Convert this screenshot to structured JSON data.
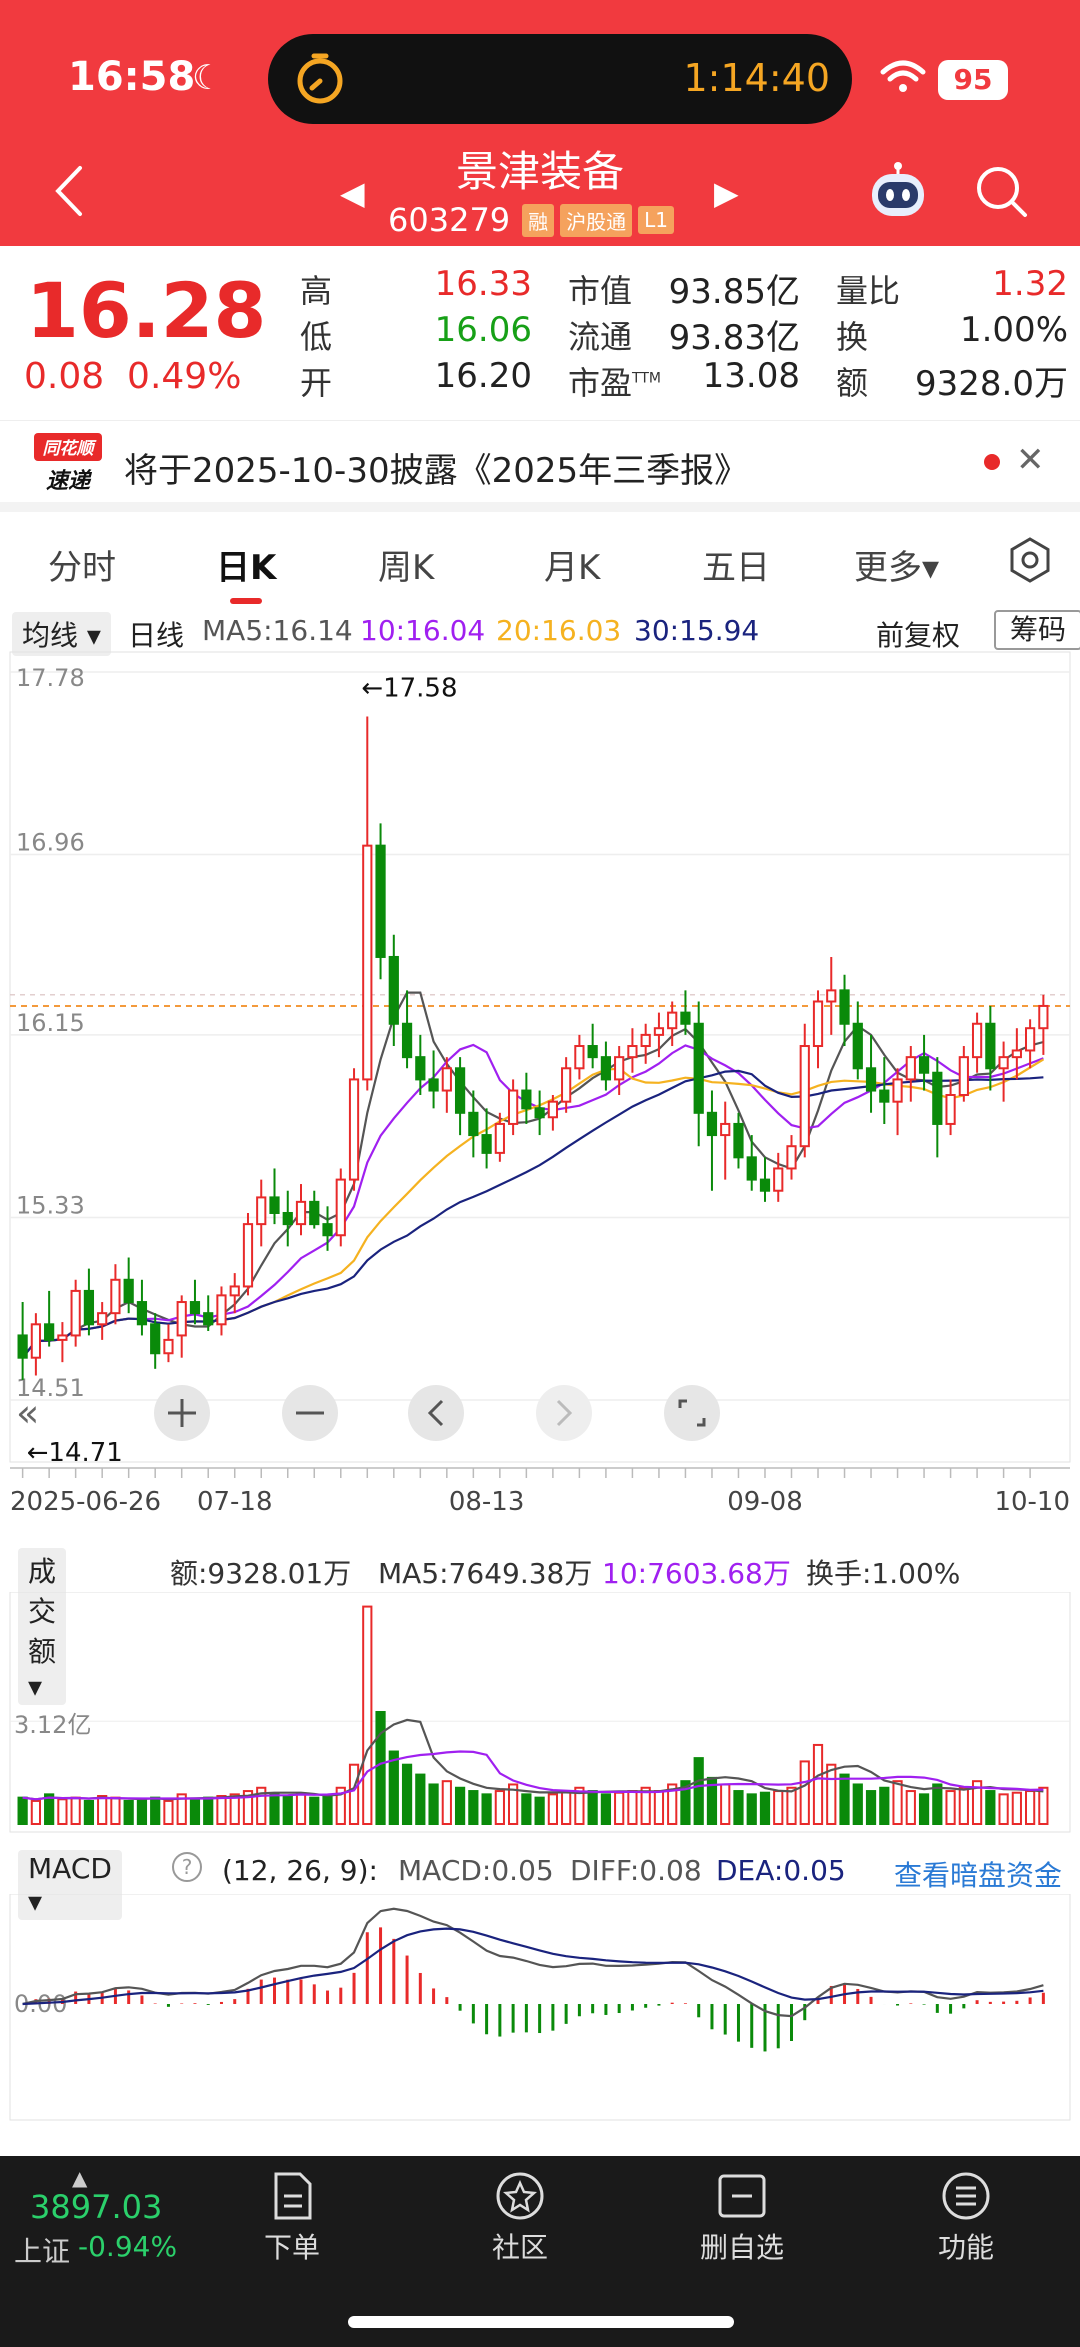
{
  "status": {
    "time": "16:58",
    "island_time": "1:14:40",
    "battery": "95"
  },
  "header": {
    "stock_name": "景津装备",
    "code": "603279",
    "tags": [
      "融",
      "沪股通",
      "L1"
    ]
  },
  "quote": {
    "price": "16.28",
    "change": "0.08",
    "change_pct": "0.49%",
    "high_label": "高",
    "high": "16.33",
    "low_label": "低",
    "low": "16.06",
    "open_label": "开",
    "open": "16.20",
    "mcap_label": "市值",
    "mcap": "93.85亿",
    "float_label": "流通",
    "float": "93.83亿",
    "pe_label": "市盈",
    "pe_sup": "TTM",
    "pe": "13.08",
    "vr_label": "量比",
    "vr": "1.32",
    "turn_label": "换",
    "turn": "1.00%",
    "amt_label": "额",
    "amt": "9328.0万"
  },
  "news": {
    "logo_top": "同花顺",
    "logo_bottom": "速递",
    "text": "将于2025-10-30披露《2025年三季报》"
  },
  "tabs": [
    "分时",
    "日K",
    "周K",
    "月K",
    "五日",
    "更多▾"
  ],
  "ma": {
    "type_label": "均线 ▾",
    "period": "日线",
    "ma5": "MA5:16.14",
    "ma10": "10:16.04",
    "ma20": "20:16.03",
    "ma30": "30:15.94",
    "adjust": "前复权",
    "chip": "筹码"
  },
  "colors": {
    "up": "#e82a2a",
    "down": "#0a8a0a",
    "ma5": "#555555",
    "ma10": "#a020f0",
    "ma20": "#f5b220",
    "ma30": "#1a237e"
  },
  "chart_data": {
    "type": "candlestick",
    "ylim": [
      14.51,
      17.78
    ],
    "y_ticks": [
      "17.78",
      "16.96",
      "16.15",
      "15.33",
      "14.51"
    ],
    "x_ticks": [
      "2025-06-26",
      "07-18",
      "08-13",
      "09-08",
      "10-10"
    ],
    "annotations": {
      "high": "←17.58",
      "low": "←14.71"
    },
    "candles": [
      [
        14.8,
        14.95,
        14.6,
        14.7
      ],
      [
        14.7,
        14.9,
        14.62,
        14.85
      ],
      [
        14.85,
        15.0,
        14.75,
        14.78
      ],
      [
        14.78,
        14.86,
        14.68,
        14.8
      ],
      [
        14.8,
        15.05,
        14.75,
        15.0
      ],
      [
        15.0,
        15.1,
        14.8,
        14.85
      ],
      [
        14.85,
        14.95,
        14.78,
        14.9
      ],
      [
        14.9,
        15.12,
        14.85,
        15.05
      ],
      [
        15.05,
        15.15,
        14.9,
        14.95
      ],
      [
        14.95,
        15.05,
        14.8,
        14.85
      ],
      [
        14.85,
        14.9,
        14.65,
        14.72
      ],
      [
        14.72,
        14.85,
        14.68,
        14.78
      ],
      [
        14.8,
        14.98,
        14.7,
        14.95
      ],
      [
        14.95,
        15.05,
        14.85,
        14.9
      ],
      [
        14.9,
        14.98,
        14.82,
        14.85
      ],
      [
        14.85,
        15.02,
        14.8,
        14.98
      ],
      [
        14.98,
        15.08,
        14.9,
        15.02
      ],
      [
        15.02,
        15.35,
        14.98,
        15.3
      ],
      [
        15.3,
        15.5,
        15.2,
        15.42
      ],
      [
        15.42,
        15.55,
        15.3,
        15.35
      ],
      [
        15.35,
        15.45,
        15.2,
        15.3
      ],
      [
        15.3,
        15.48,
        15.25,
        15.4
      ],
      [
        15.4,
        15.45,
        15.28,
        15.3
      ],
      [
        15.3,
        15.38,
        15.18,
        15.25
      ],
      [
        15.25,
        15.55,
        15.2,
        15.5
      ],
      [
        15.5,
        16.0,
        15.45,
        15.95
      ],
      [
        15.95,
        17.58,
        15.9,
        17.0
      ],
      [
        17.0,
        17.1,
        16.4,
        16.5
      ],
      [
        16.5,
        16.6,
        16.1,
        16.2
      ],
      [
        16.2,
        16.35,
        16.0,
        16.05
      ],
      [
        16.05,
        16.15,
        15.88,
        15.95
      ],
      [
        15.95,
        16.08,
        15.82,
        15.9
      ],
      [
        15.9,
        16.05,
        15.8,
        16.0
      ],
      [
        16.0,
        16.05,
        15.7,
        15.8
      ],
      [
        15.8,
        15.9,
        15.6,
        15.7
      ],
      [
        15.7,
        15.82,
        15.55,
        15.62
      ],
      [
        15.62,
        15.8,
        15.58,
        15.75
      ],
      [
        15.75,
        15.95,
        15.7,
        15.9
      ],
      [
        15.9,
        15.98,
        15.75,
        15.82
      ],
      [
        15.82,
        15.9,
        15.7,
        15.78
      ],
      [
        15.78,
        15.88,
        15.72,
        15.85
      ],
      [
        15.85,
        16.05,
        15.8,
        16.0
      ],
      [
        16.0,
        16.15,
        15.95,
        16.1
      ],
      [
        16.1,
        16.2,
        16.0,
        16.05
      ],
      [
        16.05,
        16.12,
        15.9,
        15.95
      ],
      [
        15.95,
        16.1,
        15.88,
        16.05
      ],
      [
        16.05,
        16.18,
        15.98,
        16.1
      ],
      [
        16.1,
        16.2,
        16.02,
        16.15
      ],
      [
        16.15,
        16.25,
        16.05,
        16.18
      ],
      [
        16.18,
        16.3,
        16.1,
        16.25
      ],
      [
        16.25,
        16.35,
        16.15,
        16.2
      ],
      [
        16.2,
        16.3,
        15.65,
        15.8
      ],
      [
        15.8,
        15.9,
        15.45,
        15.7
      ],
      [
        15.7,
        15.85,
        15.5,
        15.75
      ],
      [
        15.75,
        15.8,
        15.55,
        15.6
      ],
      [
        15.6,
        15.7,
        15.45,
        15.5
      ],
      [
        15.5,
        15.6,
        15.4,
        15.45
      ],
      [
        15.45,
        15.62,
        15.4,
        15.55
      ],
      [
        15.55,
        15.7,
        15.5,
        15.65
      ],
      [
        15.65,
        16.2,
        15.6,
        16.1
      ],
      [
        16.1,
        16.35,
        16.0,
        16.3
      ],
      [
        16.3,
        16.5,
        16.15,
        16.35
      ],
      [
        16.35,
        16.42,
        16.1,
        16.2
      ],
      [
        16.2,
        16.3,
        15.95,
        16.0
      ],
      [
        16.0,
        16.15,
        15.8,
        15.9
      ],
      [
        15.9,
        16.05,
        15.75,
        15.85
      ],
      [
        15.85,
        16.0,
        15.7,
        15.95
      ],
      [
        15.95,
        16.1,
        15.85,
        16.05
      ],
      [
        16.05,
        16.15,
        15.9,
        15.98
      ],
      [
        15.98,
        16.05,
        15.6,
        15.75
      ],
      [
        15.75,
        15.95,
        15.7,
        15.88
      ],
      [
        15.88,
        16.1,
        15.85,
        16.05
      ],
      [
        16.05,
        16.25,
        15.98,
        16.2
      ],
      [
        16.2,
        16.28,
        15.9,
        16.0
      ],
      [
        16.0,
        16.12,
        15.85,
        16.05
      ],
      [
        16.05,
        16.18,
        15.95,
        16.08
      ],
      [
        16.08,
        16.22,
        16.0,
        16.18
      ],
      [
        16.18,
        16.33,
        16.06,
        16.28
      ]
    ],
    "volume": {
      "label": "成交额 ▾",
      "amount": "额:9328.01万",
      "ma5": "MA5:7649.38万",
      "ma10": "10:7603.68万",
      "turnover": "换手:1.00%",
      "y_tick": "3.12亿",
      "values": [
        0.8,
        0.7,
        0.9,
        0.75,
        0.8,
        0.7,
        0.85,
        0.8,
        0.7,
        0.75,
        0.8,
        0.7,
        0.9,
        0.75,
        0.8,
        0.85,
        0.9,
        1.0,
        1.1,
        0.9,
        0.85,
        0.9,
        0.8,
        0.85,
        1.1,
        1.8,
        6.6,
        3.4,
        2.2,
        1.8,
        1.5,
        1.2,
        1.3,
        1.1,
        1.0,
        0.9,
        1.0,
        1.2,
        0.9,
        0.8,
        0.9,
        1.0,
        1.1,
        1.0,
        0.9,
        0.95,
        1.0,
        1.1,
        1.0,
        1.2,
        1.3,
        2.0,
        1.4,
        1.2,
        1.0,
        0.9,
        0.95,
        1.0,
        1.1,
        1.9,
        2.4,
        1.8,
        1.5,
        1.2,
        1.0,
        1.1,
        1.3,
        1.0,
        0.9,
        1.2,
        1.0,
        1.1,
        1.3,
        1.0,
        0.9,
        0.95,
        1.0,
        1.1
      ]
    },
    "macd": {
      "label": "MACD ▾",
      "params": "(12, 26, 9):",
      "macd": "MACD:0.05",
      "diff": "DIFF:0.08",
      "dea": "DEA:0.05",
      "link": "查看暗盘资金",
      "y_tick": "0.00"
    }
  },
  "bottom": {
    "index_value": "3897.03",
    "index_name": "上证",
    "index_change": "-0.94%",
    "nav": [
      "下单",
      "社区",
      "删自选",
      "功能"
    ]
  }
}
